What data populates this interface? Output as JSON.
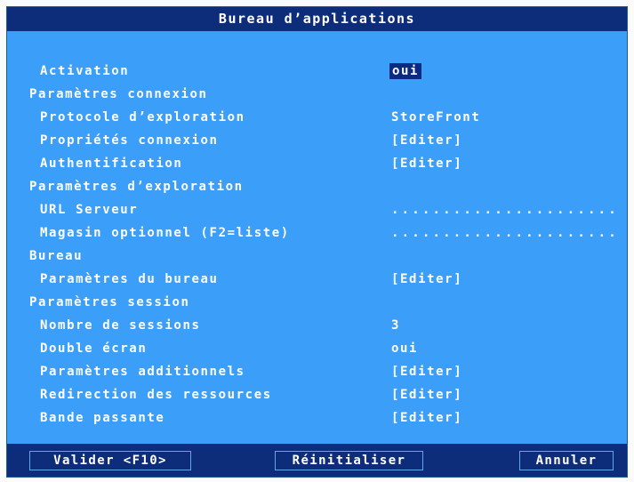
{
  "window": {
    "title": "Bureau d’applications"
  },
  "rows": [
    {
      "label": "Activation",
      "value": "oui"
    },
    {
      "label": "Paramètres connexion",
      "value": ""
    },
    {
      "label": "Protocole d’exploration",
      "value": "StoreFront"
    },
    {
      "label": "Propriétés connexion",
      "value": "[Editer]"
    },
    {
      "label": "Authentification",
      "value": "[Editer]"
    },
    {
      "label": "Paramètres d’exploration",
      "value": ""
    },
    {
      "label": "URL Serveur",
      "value": "......................"
    },
    {
      "label": "Magasin optionnel (F2=liste)",
      "value": "......................"
    },
    {
      "label": "Bureau",
      "value": ""
    },
    {
      "label": "Paramètres du bureau",
      "value": "[Editer]"
    },
    {
      "label": "Paramètres session",
      "value": ""
    },
    {
      "label": "Nombre de sessions",
      "value": "3"
    },
    {
      "label": "Double écran",
      "value": "oui"
    },
    {
      "label": "Paramètres additionnels",
      "value": "[Editer]"
    },
    {
      "label": "Redirection des ressources",
      "value": "[Editer]"
    },
    {
      "label": "Bande passante",
      "value": "[Editer]"
    }
  ],
  "buttons": {
    "validate": "Valider <F10>",
    "reset": "Réinitialiser",
    "cancel": "Annuler"
  },
  "colors": {
    "background": "#3b9ef8",
    "titlebar": "#0d2d7a",
    "selection": "#0a2a83",
    "text": "#ffffff"
  }
}
